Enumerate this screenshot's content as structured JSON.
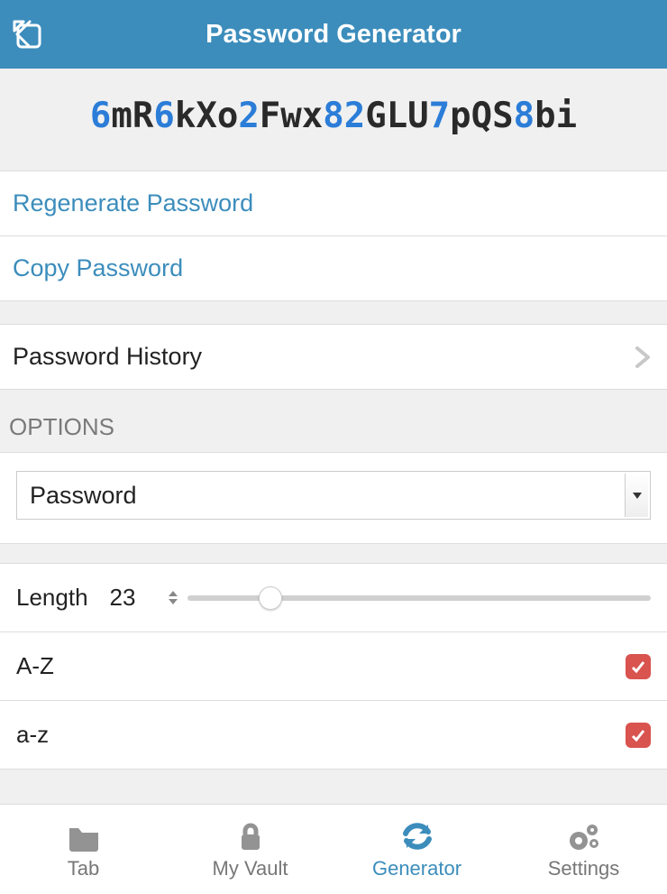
{
  "header": {
    "title": "Password Generator"
  },
  "password": {
    "segments": [
      {
        "t": "6",
        "d": true
      },
      {
        "t": "mR",
        "d": false
      },
      {
        "t": "6",
        "d": true
      },
      {
        "t": "kXo",
        "d": false
      },
      {
        "t": "2",
        "d": true
      },
      {
        "t": "Fwx",
        "d": false
      },
      {
        "t": "82",
        "d": true
      },
      {
        "t": "GLU",
        "d": false
      },
      {
        "t": "7",
        "d": true
      },
      {
        "t": "pQS",
        "d": false
      },
      {
        "t": "8",
        "d": true
      },
      {
        "t": "bi",
        "d": false
      }
    ]
  },
  "actions": {
    "regenerate": "Regenerate Password",
    "copy": "Copy Password",
    "history": "Password History"
  },
  "options": {
    "header": "OPTIONS",
    "type_selected": "Password",
    "length_label": "Length",
    "length_value": "23",
    "slider_percent": 18,
    "uppercase_label": "A-Z",
    "uppercase_checked": true,
    "lowercase_label": "a-z",
    "lowercase_checked": true
  },
  "tabs": {
    "tab": "Tab",
    "vault": "My Vault",
    "generator": "Generator",
    "settings": "Settings",
    "active": "generator"
  }
}
